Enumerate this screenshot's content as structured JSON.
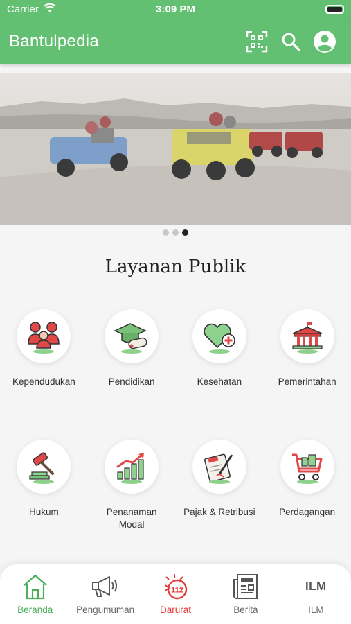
{
  "status_bar": {
    "carrier": "Carrier",
    "time": "3:09 PM"
  },
  "app_bar": {
    "title": "Bantulpedia"
  },
  "carousel": {
    "total": 3,
    "active": 3
  },
  "section": {
    "title": "Layanan Publik"
  },
  "services": [
    {
      "label": "Kependudukan",
      "icon": "people-icon"
    },
    {
      "label": "Pendidikan",
      "icon": "graduation-cap-icon"
    },
    {
      "label": "Kesehatan",
      "icon": "heart-plus-icon"
    },
    {
      "label": "Pemerintahan",
      "icon": "government-building-icon"
    },
    {
      "label": "Hukum",
      "icon": "gavel-icon"
    },
    {
      "label": "Penanaman Modal",
      "label_line1": "Penanaman",
      "label_line2": "Modal",
      "icon": "growth-chart-icon"
    },
    {
      "label": "Pajak & Retribusi",
      "icon": "tax-document-icon"
    },
    {
      "label": "Perdagangan",
      "icon": "shopping-cart-icon"
    }
  ],
  "tabs": [
    {
      "label": "Beranda",
      "icon": "home-icon",
      "active": true
    },
    {
      "label": "Pengumuman",
      "icon": "megaphone-icon"
    },
    {
      "label": "Darurat",
      "icon": "emergency-112-icon"
    },
    {
      "label": "Berita",
      "icon": "newspaper-icon"
    },
    {
      "label": "ILM",
      "icon": "ilm-icon",
      "icon_text": "ILM"
    }
  ],
  "colors": {
    "primary": "#63c072",
    "active_tab": "#4cae5a",
    "danger": "#e53935"
  }
}
